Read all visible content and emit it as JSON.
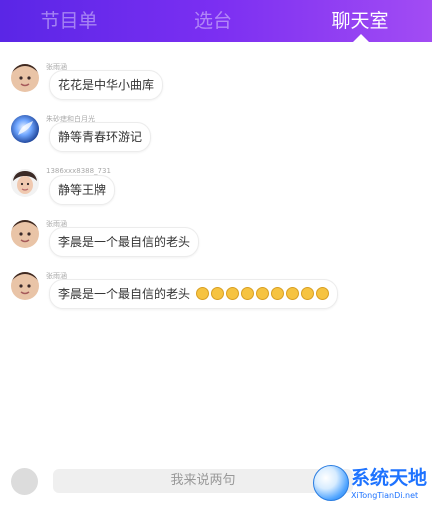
{
  "tabs": [
    "节目单",
    "选台",
    "聊天室"
  ],
  "messages": [
    {
      "name": "张雨涵",
      "text": "花花是中华小曲库",
      "emoji_count": 0
    },
    {
      "name": "朱砂痣和白月光",
      "text": "静等青春环游记",
      "emoji_count": 0
    },
    {
      "name": "1386xxx8388_731",
      "text": "静等王牌",
      "emoji_count": 0
    },
    {
      "name": "张雨涵",
      "text": "李晨是一个最自信的老头",
      "emoji_count": 0
    },
    {
      "name": "张雨涵",
      "text": "李晨是一个最自信的老头",
      "emoji_count": 9
    }
  ],
  "input": {
    "placeholder": "我来说两句"
  },
  "watermark": {
    "title": "系统天地",
    "url": "XiTongTianDi.net"
  },
  "colors": {
    "accent_left": "#5a26e6",
    "accent_right": "#a24cf3",
    "logo_blue": "#1e73ff"
  }
}
